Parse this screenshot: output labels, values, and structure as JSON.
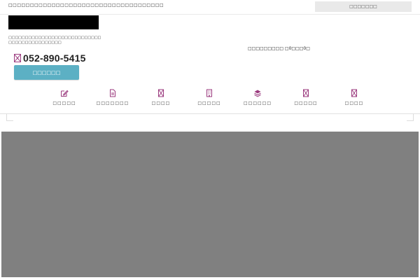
{
  "topbar": {
    "text": "□□□□□□□□□□□□□□□□□□□□□□□□□□□□□□□□□□□□",
    "search_button": "□□□□□□□"
  },
  "header": {
    "tagline": "□□□□□□□□□□□□□□□□□□□□□□□□□□□□□□□□□□□□□□□□□□□□",
    "center_note": "□□□□□□□□□ □0□□□0□",
    "phone": "052-890-5415",
    "contact_button": "□□□□□□"
  },
  "nav": {
    "items": [
      {
        "label": "□□□□□",
        "icon": "edit-icon"
      },
      {
        "label": "□□□□□□□",
        "icon": "document-icon"
      },
      {
        "label": "□□□□",
        "icon": "placeholder-icon"
      },
      {
        "label": "□□□□□",
        "icon": "building-icon"
      },
      {
        "label": "□□□□□□",
        "icon": "layers-icon"
      },
      {
        "label": "□□□□□",
        "icon": "placeholder-icon"
      },
      {
        "label": "□□□□",
        "icon": "placeholder-icon"
      }
    ]
  },
  "colors": {
    "accent": "#9b3a7e",
    "button": "#5cb0c4",
    "hero": "#808080",
    "logo": "#000000"
  }
}
